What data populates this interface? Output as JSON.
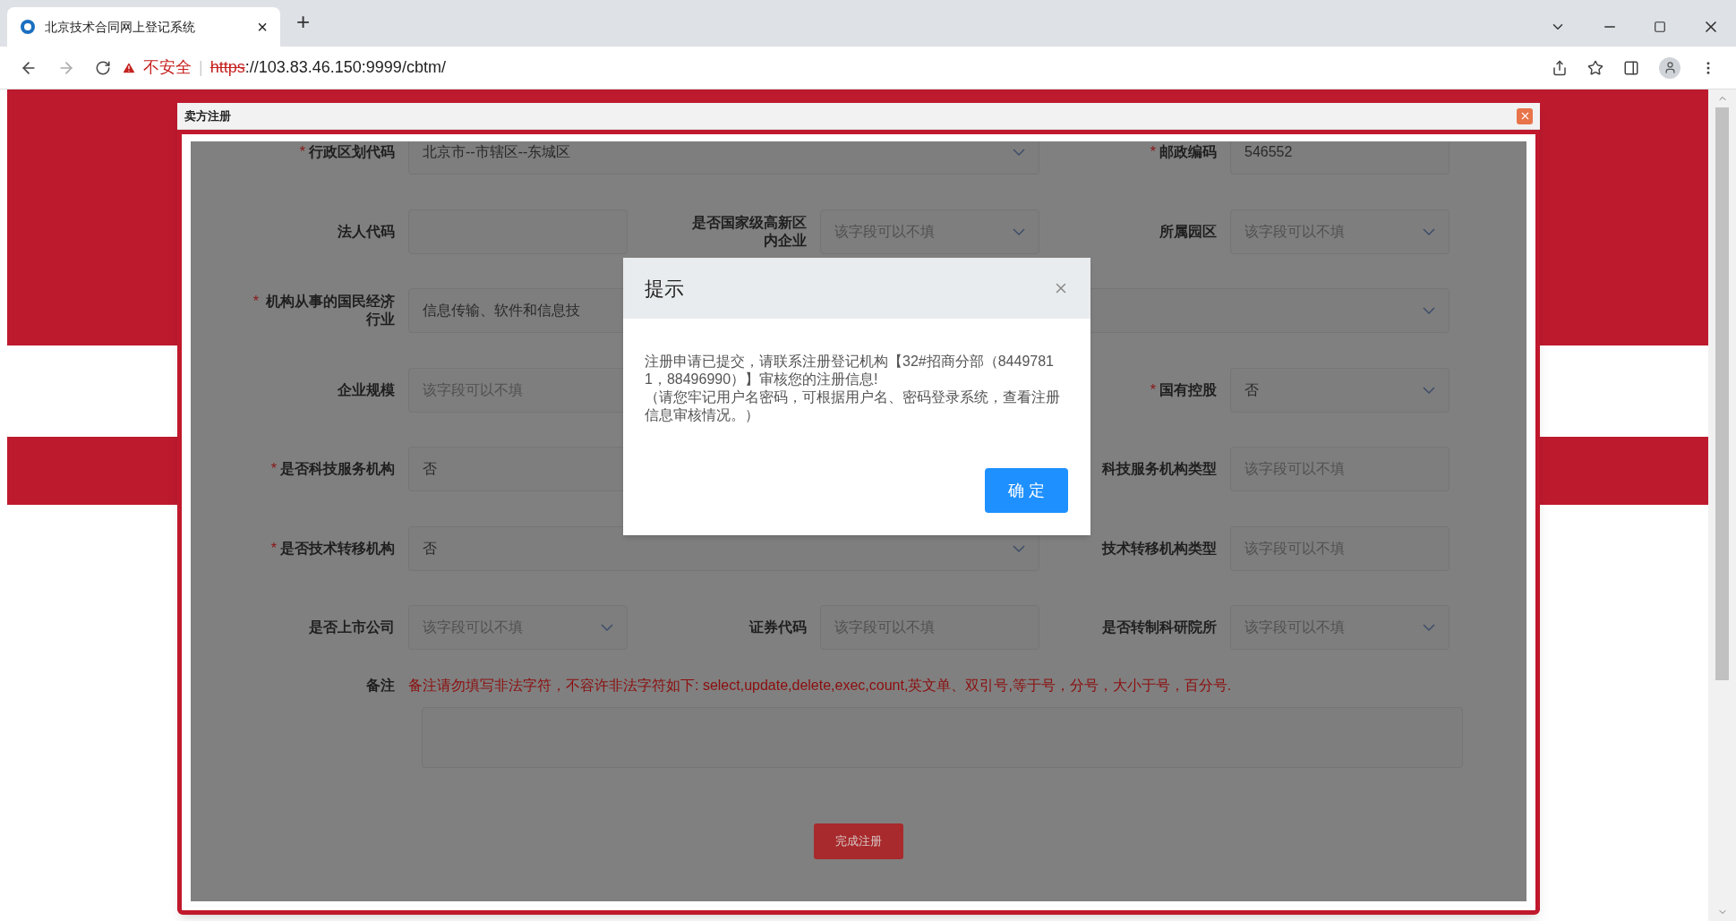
{
  "browser": {
    "tab": {
      "title": "北京技术合同网上登记系统",
      "close": "×",
      "new_tab": "+"
    },
    "address": {
      "security_label": "不安全",
      "separator": "|",
      "scheme": "https",
      "rest": "://103.83.46.150:9999/cbtm/"
    }
  },
  "modal": {
    "title": "卖方注册"
  },
  "form": {
    "rows": [
      {
        "fields": [
          {
            "label": "行政区划代码",
            "required_mark": "*",
            "kind": "select",
            "value": "北京市--市辖区--东城区"
          },
          {
            "label": "邮政编码",
            "required_mark": "*",
            "kind": "input",
            "value": "546552"
          }
        ]
      },
      {
        "fields": [
          {
            "label": "法人代码",
            "kind": "input"
          },
          {
            "label": "是否国家级高新区内企业",
            "kind": "select",
            "placeholder": "该字段可以不填"
          },
          {
            "label": "所属园区",
            "kind": "select",
            "placeholder": "该字段可以不填"
          }
        ]
      },
      {
        "fields": [
          {
            "label": "机构从事的国民经济行业",
            "required_mark": "*",
            "kind": "select",
            "value": "信息传输、软件和信息技"
          }
        ]
      },
      {
        "fields": [
          {
            "label": "企业规模",
            "kind": "input",
            "placeholder": "该字段可以不填"
          },
          {
            "label": "国有控股",
            "required_mark": "*",
            "kind": "select",
            "value": "否"
          }
        ]
      },
      {
        "fields": [
          {
            "label": "是否科技服务机构",
            "required_mark": "*",
            "kind": "input",
            "value": "否"
          },
          {
            "label": "科技服务机构类型",
            "kind": "input",
            "placeholder": "该字段可以不填"
          }
        ]
      },
      {
        "fields": [
          {
            "label": "是否技术转移机构",
            "required_mark": "*",
            "kind": "select",
            "value": "否"
          },
          {
            "label": "技术转移机构类型",
            "kind": "input",
            "placeholder": "该字段可以不填"
          }
        ]
      },
      {
        "fields": [
          {
            "label": "是否上市公司",
            "kind": "select",
            "placeholder": "该字段可以不填"
          },
          {
            "label": "证券代码",
            "kind": "input",
            "placeholder": "该字段可以不填"
          },
          {
            "label": "是否转制科研院所",
            "kind": "select",
            "placeholder": "该字段可以不填"
          }
        ]
      }
    ],
    "remark": {
      "label": "备注",
      "note": "备注请勿填写非法字符，不容许非法字符如下: select,update,delete,exec,count,英文单、双引号,等于号，分号，大小于号，百分号."
    },
    "submit": "完成注册"
  },
  "dialog": {
    "title": "提示",
    "message": "注册申请已提交，请联系注册登记机构【32#招商分部（84497811，88496990）】审核您的注册信息!",
    "note": "（请您牢记用户名密码，可根据用户名、密码登录系统，查看注册信息审核情况。）",
    "ok": "确 定"
  }
}
